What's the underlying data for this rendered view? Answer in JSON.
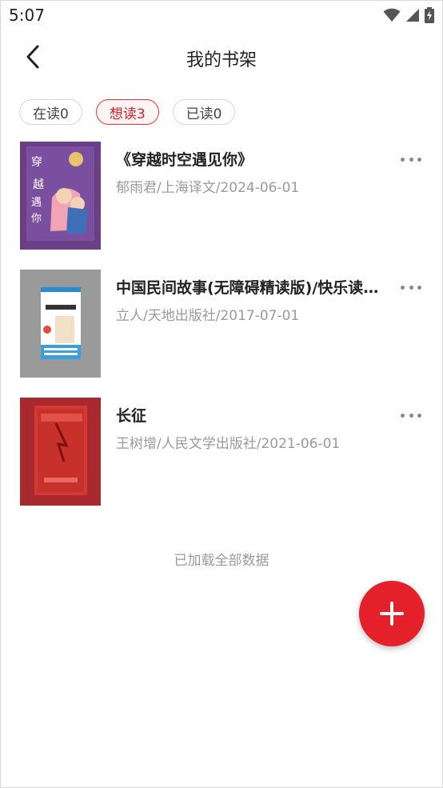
{
  "status_bar": {
    "time": "5:07",
    "icons": [
      "wifi-icon",
      "signal-icon",
      "battery-charging-icon"
    ]
  },
  "header": {
    "back_icon": "chevron-left-icon",
    "title": "我的书架"
  },
  "tabs": [
    {
      "label": "在读0",
      "active": false
    },
    {
      "label": "想读3",
      "active": true
    },
    {
      "label": "已读0",
      "active": false
    }
  ],
  "books": [
    {
      "title": "《穿越时空遇见你》",
      "meta": "郁雨君/上海译文/2024-06-01",
      "cover_color": "#6a3f86"
    },
    {
      "title": "中国民间故事(无障碍精读版)/快乐读书吧",
      "meta": "立人/天地出版社/2017-07-01",
      "cover_color": "#9a9a9a"
    },
    {
      "title": "长征",
      "meta": "王树增/人民文学出版社/2021-06-01",
      "cover_color": "#a8292e"
    }
  ],
  "footer": {
    "loaded_text": "已加载全部数据"
  },
  "fab": {
    "icon": "plus-icon",
    "color": "#e4212b"
  },
  "colors": {
    "accent": "#e4212b",
    "active_tab_text": "#d9232a",
    "meta_text": "#9a9a9a"
  }
}
